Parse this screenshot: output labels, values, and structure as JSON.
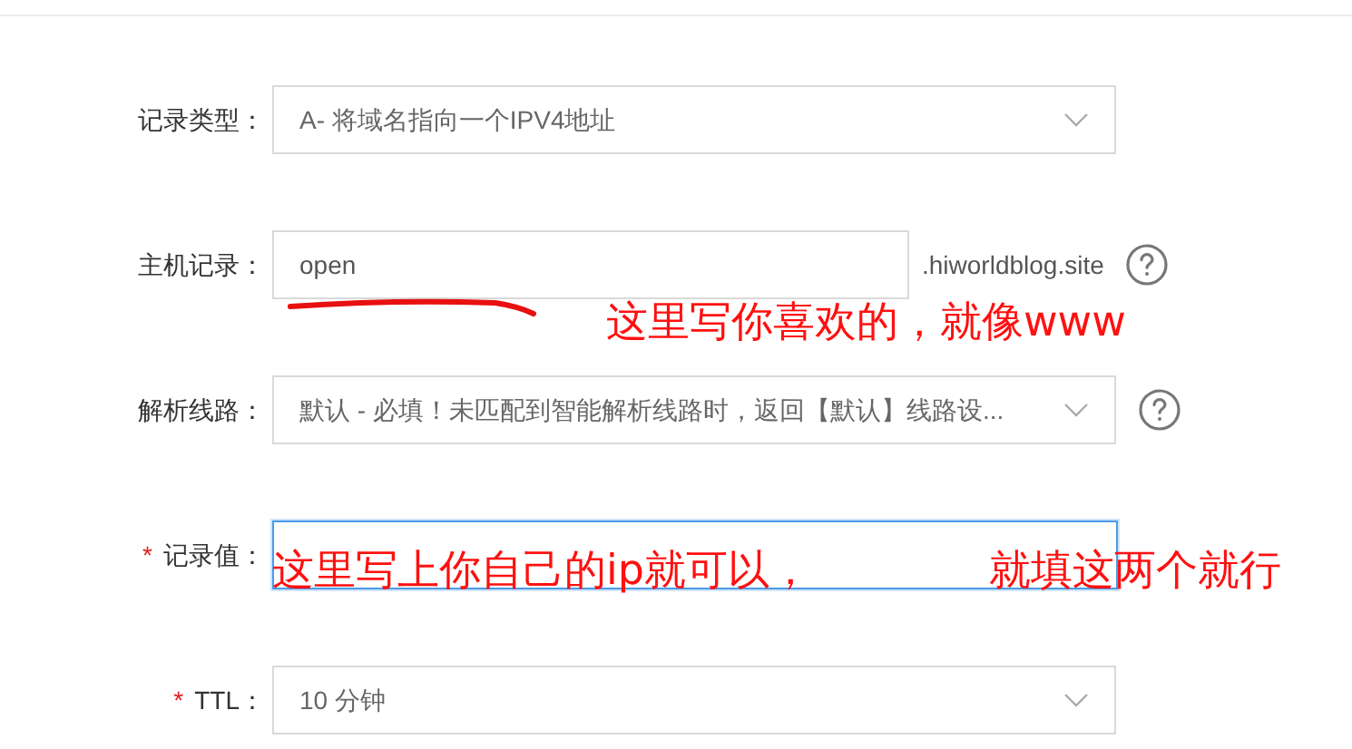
{
  "fields": [
    {
      "label": "记录类型：",
      "kind": "select",
      "value": "A- 将域名指向一个IPV4地址",
      "focused": false,
      "help": false
    },
    {
      "label": "主机记录：",
      "kind": "input",
      "value": "open",
      "suffix": ".hiworldblog.site",
      "focused": false,
      "help": true
    },
    {
      "label": "解析线路：",
      "kind": "select",
      "value": "默认 - 必填！未匹配到智能解析线路时，返回【默认】线路设...",
      "focused": false,
      "help": true
    },
    {
      "label": "记录值：",
      "required_mark": "*",
      "kind": "input",
      "focused": true,
      "help": false
    },
    {
      "label": "TTL：",
      "required_mark": "*",
      "kind": "select",
      "value": "10 分钟",
      "focused": false,
      "help": false
    }
  ],
  "annotations": [
    "这里写你喜欢的，就像www",
    "这里写上你自己的ip就可以，",
    "就填这两个就行"
  ]
}
